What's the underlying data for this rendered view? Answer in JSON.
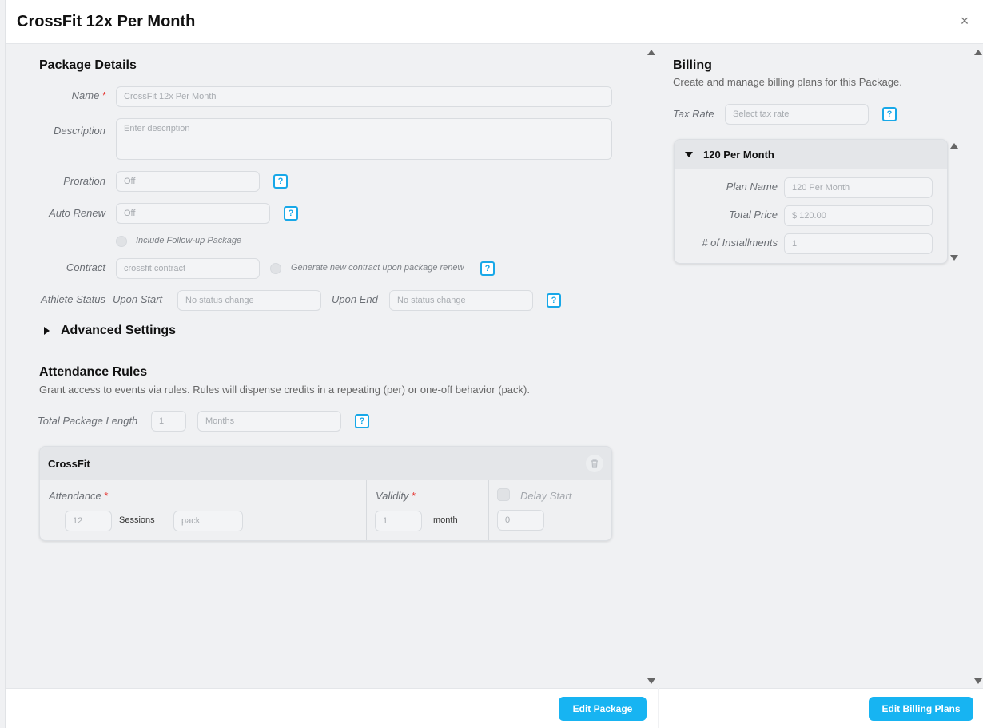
{
  "modal": {
    "title": "CrossFit 12x Per Month",
    "close_icon": "close-icon"
  },
  "package_details": {
    "title": "Package Details",
    "name": {
      "label": "Name",
      "required_mark": "*",
      "value": "CrossFit 12x Per Month"
    },
    "description": {
      "label": "Description",
      "placeholder": "Enter description"
    },
    "proration": {
      "label": "Proration",
      "value": "Off",
      "help": "?"
    },
    "auto_renew": {
      "label": "Auto Renew",
      "value": "Off",
      "help": "?"
    },
    "follow_up": {
      "label": "Include Follow-up Package"
    },
    "contract": {
      "label": "Contract",
      "value": "crossfit contract",
      "generate_label": "Generate new contract upon package renew",
      "help": "?"
    },
    "athlete_status": {
      "label": "Athlete Status",
      "upon_start_label": "Upon Start",
      "upon_start_value": "No status change",
      "upon_end_label": "Upon End",
      "upon_end_value": "No status change",
      "help": "?"
    },
    "advanced_settings": "Advanced Settings"
  },
  "attendance_rules": {
    "title": "Attendance Rules",
    "subtitle": "Grant access to events via rules. Rules will dispense credits in a repeating (per) or one-off behavior (pack).",
    "total_length": {
      "label": "Total Package Length",
      "value": "1",
      "unit": "Months",
      "help": "?"
    },
    "rule_card": {
      "title": "CrossFit",
      "attendance_label": "Attendance",
      "required_mark": "*",
      "sessions_value": "12",
      "sessions_label": "Sessions",
      "mode_value": "pack",
      "validity_label": "Validity",
      "validity_value": "1",
      "validity_unit": "month",
      "delay_start_label": "Delay Start",
      "delay_value": "0"
    }
  },
  "billing": {
    "title": "Billing",
    "subtitle": "Create and manage billing plans for this Package.",
    "tax_rate": {
      "label": "Tax Rate",
      "placeholder": "Select tax rate",
      "help": "?"
    },
    "plan": {
      "title": "120 Per Month",
      "plan_name_label": "Plan Name",
      "plan_name_value": "120 Per Month",
      "total_price_label": "Total Price",
      "total_price_value": "$ 120.00",
      "installments_label": "# of Installments",
      "installments_value": "1"
    }
  },
  "footer": {
    "edit_package": "Edit Package",
    "edit_billing_plans": "Edit Billing Plans"
  },
  "colors": {
    "accent": "#17b4f2",
    "help": "#18a8e8",
    "required": "#e53935"
  }
}
